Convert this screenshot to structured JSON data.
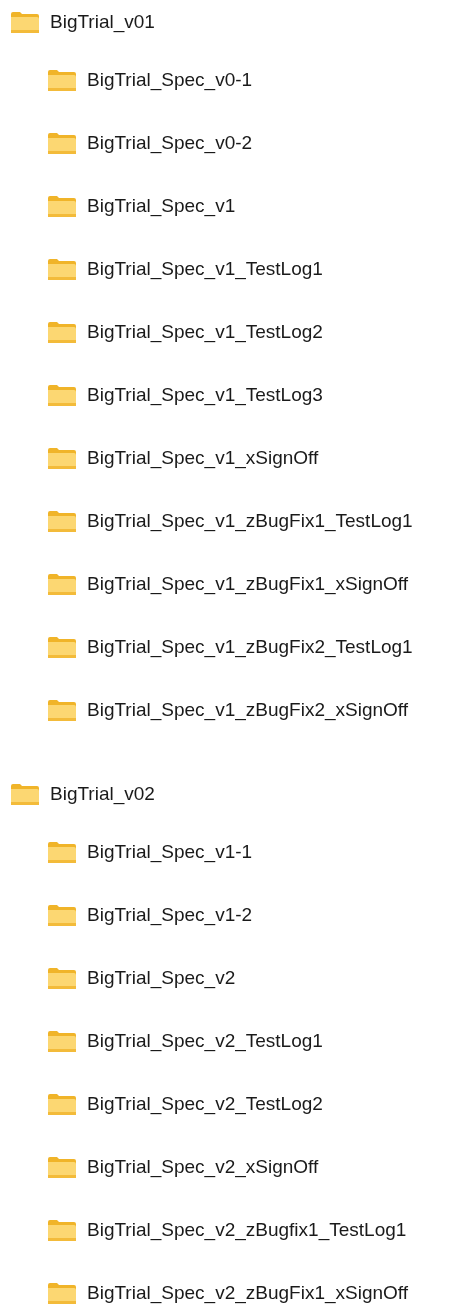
{
  "folders": [
    {
      "name": "BigTrial_v01",
      "children": [
        {
          "name": "BigTrial_Spec_v0-1"
        },
        {
          "name": "BigTrial_Spec_v0-2"
        },
        {
          "name": "BigTrial_Spec_v1"
        },
        {
          "name": "BigTrial_Spec_v1_TestLog1"
        },
        {
          "name": "BigTrial_Spec_v1_TestLog2"
        },
        {
          "name": "BigTrial_Spec_v1_TestLog3"
        },
        {
          "name": "BigTrial_Spec_v1_xSignOff"
        },
        {
          "name": "BigTrial_Spec_v1_zBugFix1_TestLog1"
        },
        {
          "name": "BigTrial_Spec_v1_zBugFix1_xSignOff"
        },
        {
          "name": "BigTrial_Spec_v1_zBugFix2_TestLog1"
        },
        {
          "name": "BigTrial_Spec_v1_zBugFix2_xSignOff"
        }
      ]
    },
    {
      "name": "BigTrial_v02",
      "children": [
        {
          "name": "BigTrial_Spec_v1-1"
        },
        {
          "name": "BigTrial_Spec_v1-2"
        },
        {
          "name": "BigTrial_Spec_v2"
        },
        {
          "name": "BigTrial_Spec_v2_TestLog1"
        },
        {
          "name": "BigTrial_Spec_v2_TestLog2"
        },
        {
          "name": "BigTrial_Spec_v2_xSignOff"
        },
        {
          "name": "BigTrial_Spec_v2_zBugfix1_TestLog1"
        },
        {
          "name": "BigTrial_Spec_v2_zBugFix1_xSignOff"
        }
      ]
    }
  ]
}
